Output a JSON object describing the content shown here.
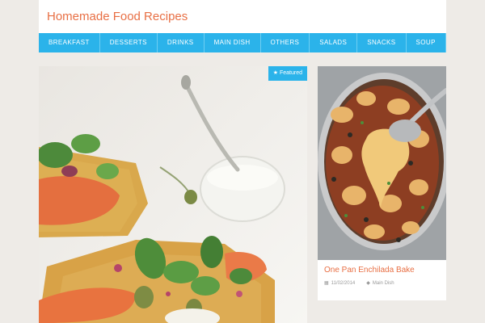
{
  "site": {
    "title": "Homemade Food Recipes"
  },
  "nav": {
    "items": [
      {
        "label": "BREAKFAST"
      },
      {
        "label": "DESSERTS"
      },
      {
        "label": "DRINKS"
      },
      {
        "label": "MAIN DISH"
      },
      {
        "label": "OTHERS"
      },
      {
        "label": "SALADS"
      },
      {
        "label": "SNACKS"
      },
      {
        "label": "SOUP"
      }
    ]
  },
  "featured": {
    "badge_label": "Featured",
    "badge_icon": "star-icon"
  },
  "side_post": {
    "title": "One Pan Enchilada Bake",
    "date": "11/02/2014",
    "category": "Main Dish",
    "date_icon": "calendar-icon",
    "category_icon": "tag-icon"
  },
  "colors": {
    "accent_orange": "#e86f44",
    "nav_blue": "#2bb3ea",
    "page_bg": "#eeebe7"
  }
}
